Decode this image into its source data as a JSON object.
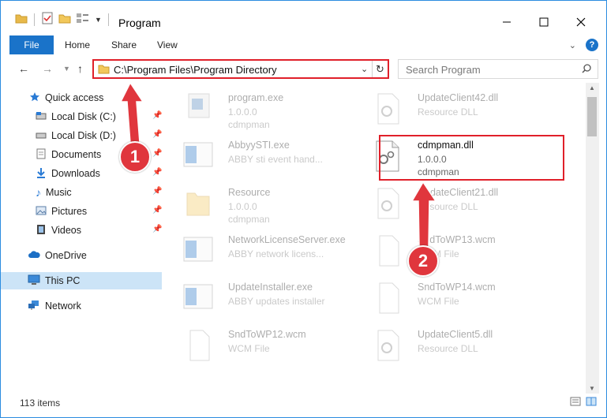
{
  "window": {
    "title": "Program"
  },
  "ribbon": {
    "file": "File",
    "home": "Home",
    "share": "Share",
    "view": "View"
  },
  "address": {
    "path": "C:\\Program Files\\Program Directory"
  },
  "search": {
    "placeholder": "Search Program"
  },
  "nav": {
    "quick_access": "Quick access",
    "local_c": "Local Disk (C:)",
    "local_d": "Local Disk (D:)",
    "documents": "Documents",
    "downloads": "Downloads",
    "music": "Music",
    "pictures": "Pictures",
    "videos": "Videos",
    "onedrive": "OneDrive",
    "this_pc": "This PC",
    "network": "Network"
  },
  "files": {
    "f1": {
      "name": "program.exe",
      "sub1": "1.0.0.0",
      "sub2": "cdmpman"
    },
    "f2": {
      "name": "AbbyySTI.exe",
      "sub1": "ABBY sti event hand..."
    },
    "f3": {
      "name": "Resource",
      "sub1": "1.0.0.0",
      "sub2": "cdmpman"
    },
    "f4": {
      "name": "NetworkLicenseServer.exe",
      "sub1": "ABBY network licens..."
    },
    "f5": {
      "name": "UpdateInstaller.exe",
      "sub1": "ABBY updates installer"
    },
    "f6": {
      "name": "SndToWP12.wcm",
      "sub1": "WCM File"
    },
    "g1": {
      "name": "UpdateClient42.dll",
      "sub1": "Resource DLL"
    },
    "g2": {
      "name": "cdmpman.dll",
      "sub1": "1.0.0.0",
      "sub2": "cdmpman"
    },
    "g3": {
      "name": "UpdateClient21.dll",
      "sub1": "Resource DLL"
    },
    "g4": {
      "name": "SndToWP13.wcm",
      "sub1": "WCM File"
    },
    "g5": {
      "name": "SndToWP14.wcm",
      "sub1": "WCM File"
    },
    "g6": {
      "name": "UpdateClient5.dll",
      "sub1": "Resource DLL"
    }
  },
  "status": {
    "items": "113 items"
  },
  "callouts": {
    "one": "1",
    "two": "2"
  },
  "colors": {
    "accent": "#1a73c9",
    "highlight": "#e0202a",
    "callout": "#e0363d"
  }
}
